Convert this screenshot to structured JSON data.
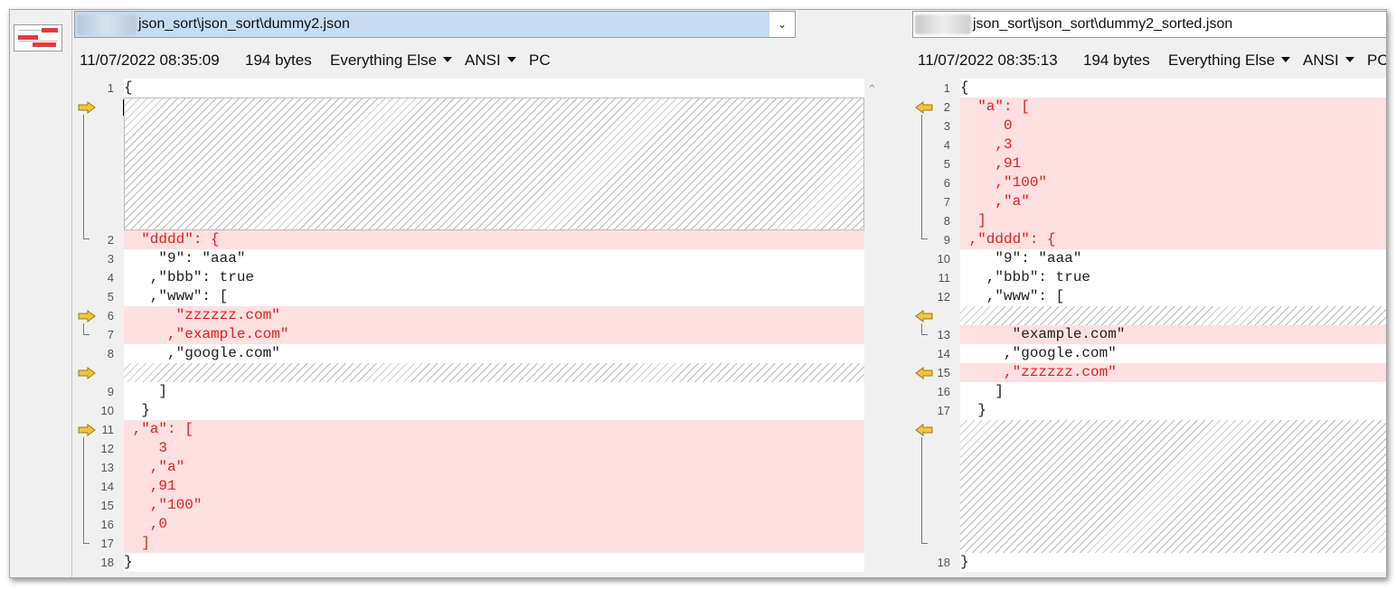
{
  "left": {
    "path": "json_sort\\json_sort\\dummy2.json",
    "info": {
      "timestamp": "11/07/2022 08:35:09",
      "size": "194 bytes",
      "format": "Everything Else",
      "encoding": "ANSI",
      "line_ending": "PC"
    },
    "lines": [
      {
        "n": "1",
        "t": "{"
      },
      {
        "n": "2",
        "t": "  \"dddd\": {"
      },
      {
        "n": "3",
        "t": "    \"9\": \"aaa\""
      },
      {
        "n": "4",
        "t": "   ,\"bbb\": true"
      },
      {
        "n": "5",
        "t": "   ,\"www\": ["
      },
      {
        "n": "6",
        "t": "      \"zzzzzz.com\""
      },
      {
        "n": "7",
        "t": "     ,\"example.com\""
      },
      {
        "n": "8",
        "t": "     ,\"google.com\""
      },
      {
        "n": "9",
        "t": "    ]"
      },
      {
        "n": "10",
        "t": "  }"
      },
      {
        "n": "11",
        "t": " ,\"a\": ["
      },
      {
        "n": "12",
        "t": "    3"
      },
      {
        "n": "13",
        "t": "   ,\"a\""
      },
      {
        "n": "14",
        "t": "   ,91"
      },
      {
        "n": "15",
        "t": "   ,\"100\""
      },
      {
        "n": "16",
        "t": "   ,0"
      },
      {
        "n": "17",
        "t": "  ]"
      },
      {
        "n": "18",
        "t": "}"
      }
    ]
  },
  "right": {
    "path": "json_sort\\json_sort\\dummy2_sorted.json",
    "info": {
      "timestamp": "11/07/2022 08:35:13",
      "size": "194 bytes",
      "format": "Everything Else",
      "encoding": "ANSI",
      "line_ending": "PC"
    },
    "lines": [
      {
        "n": "1",
        "t": "{"
      },
      {
        "n": "2",
        "t": "  \"a\": ["
      },
      {
        "n": "3",
        "t": "     0"
      },
      {
        "n": "4",
        "t": "    ,3"
      },
      {
        "n": "5",
        "t": "    ,91"
      },
      {
        "n": "6",
        "t": "    ,\"100\""
      },
      {
        "n": "7",
        "t": "    ,\"a\""
      },
      {
        "n": "8",
        "t": "  ]"
      },
      {
        "n": "9",
        "t": " ,\"dddd\": {"
      },
      {
        "n": "10",
        "t": "    \"9\": \"aaa\""
      },
      {
        "n": "11",
        "t": "   ,\"bbb\": true"
      },
      {
        "n": "12",
        "t": "   ,\"www\": ["
      },
      {
        "n": "13",
        "t": "      \"example.com\""
      },
      {
        "n": "14",
        "t": "     ,\"google.com\""
      },
      {
        "n": "15",
        "t": "     ,\"zzzzzz.com\""
      },
      {
        "n": "16",
        "t": "    ]"
      },
      {
        "n": "17",
        "t": "  }"
      },
      {
        "n": "18",
        "t": "}"
      }
    ]
  },
  "colors": {
    "diff_background": "#ffe0e0",
    "diff_text": "#e02020",
    "arrow": "#f2c43d",
    "selection": "#c5dcf2"
  },
  "icons": {
    "overview": "file-compare-overview-icon",
    "change_arrow_right": "arrow-right-icon",
    "change_arrow_left": "arrow-left-icon",
    "dropdown": "chevron-down-icon",
    "scroll_up": "scroll-up-icon"
  }
}
